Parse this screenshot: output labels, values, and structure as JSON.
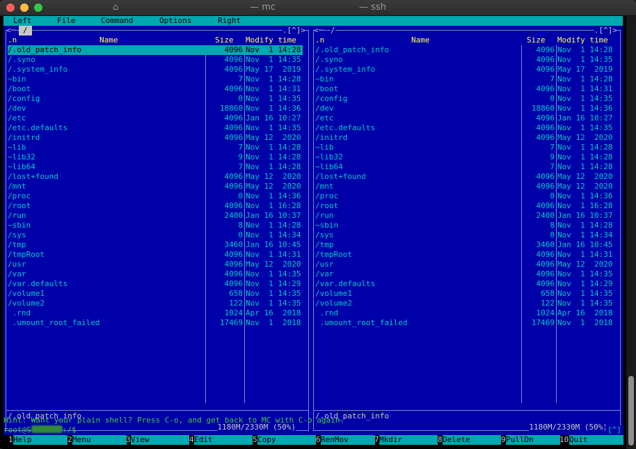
{
  "window": {
    "title_left": "— mc",
    "title_right": "— ssh"
  },
  "menubar": [
    "Left",
    "File",
    "Command",
    "Options",
    "Right"
  ],
  "columns": {
    "name": "Name",
    "size": "Size",
    "mtime": "Modify time",
    "sort": ".n"
  },
  "panels": [
    {
      "path": "/",
      "corner": ".[^]>",
      "nav_left": "<─",
      "selected_index": 0,
      "mini_status": "/.old_patch_info",
      "free_space": "1180M/2330M (50%)"
    },
    {
      "path": "/",
      "corner": ".[^]>",
      "nav_left": "<─",
      "selected_index": -1,
      "mini_status": "/.old_patch_info",
      "free_space": "1180M/2330M (50%)"
    }
  ],
  "files": [
    {
      "name": "/.old_patch_info",
      "size": "4096",
      "mtime": "Nov  1 14:28"
    },
    {
      "name": "/.syno",
      "size": "4096",
      "mtime": "Nov  1 14:35"
    },
    {
      "name": "/.system_info",
      "size": "4096",
      "mtime": "May 17  2019"
    },
    {
      "name": "~bin",
      "size": "7",
      "mtime": "Nov  1 14:28"
    },
    {
      "name": "/boot",
      "size": "4096",
      "mtime": "Nov  1 14:31"
    },
    {
      "name": "/config",
      "size": "0",
      "mtime": "Nov  1 14:35"
    },
    {
      "name": "/dev",
      "size": "18860",
      "mtime": "Nov  1 14:36"
    },
    {
      "name": "/etc",
      "size": "4096",
      "mtime": "Jan 16 10:27"
    },
    {
      "name": "/etc.defaults",
      "size": "4096",
      "mtime": "Nov  1 14:35"
    },
    {
      "name": "/initrd",
      "size": "4096",
      "mtime": "May 12  2020"
    },
    {
      "name": "~lib",
      "size": "7",
      "mtime": "Nov  1 14:28"
    },
    {
      "name": "~lib32",
      "size": "9",
      "mtime": "Nov  1 14:28"
    },
    {
      "name": "~lib64",
      "size": "7",
      "mtime": "Nov  1 14:28"
    },
    {
      "name": "/lost+found",
      "size": "4096",
      "mtime": "May 12  2020"
    },
    {
      "name": "/mnt",
      "size": "4096",
      "mtime": "May 12  2020"
    },
    {
      "name": "/proc",
      "size": "0",
      "mtime": "Nov  1 14:36"
    },
    {
      "name": "/root",
      "size": "4096",
      "mtime": "Nov  1 16:28"
    },
    {
      "name": "/run",
      "size": "2400",
      "mtime": "Jan 16 10:37"
    },
    {
      "name": "~sbin",
      "size": "8",
      "mtime": "Nov  1 14:28"
    },
    {
      "name": "/sys",
      "size": "0",
      "mtime": "Nov  1 14:34"
    },
    {
      "name": "/tmp",
      "size": "3460",
      "mtime": "Jan 16 10:45"
    },
    {
      "name": "/tmpRoot",
      "size": "4096",
      "mtime": "Nov  1 14:31"
    },
    {
      "name": "/usr",
      "size": "4096",
      "mtime": "May 12  2020"
    },
    {
      "name": "/var",
      "size": "4096",
      "mtime": "Nov  1 14:35"
    },
    {
      "name": "/var.defaults",
      "size": "4096",
      "mtime": "Nov  1 14:29"
    },
    {
      "name": "/volume1",
      "size": "658",
      "mtime": "Nov  1 14:35"
    },
    {
      "name": "/volume2",
      "size": "122",
      "mtime": "Nov  1 14:35"
    },
    {
      "name": " .rnd",
      "size": "1024",
      "mtime": "Apr 16  2018"
    },
    {
      "name": " .umount_root_failed",
      "size": "17469",
      "mtime": "Nov  1  2018"
    }
  ],
  "hint": "Hint: Want your plain shell? Press C-o, and get back to MC with C-o again.",
  "prompt": {
    "user": "root@S",
    "suffix": ":/$"
  },
  "history_button": "[^]",
  "fkeys": [
    {
      "num": "1",
      "label": "Help"
    },
    {
      "num": "2",
      "label": "Menu"
    },
    {
      "num": "3",
      "label": "View"
    },
    {
      "num": "4",
      "label": "Edit"
    },
    {
      "num": "5",
      "label": "Copy"
    },
    {
      "num": "6",
      "label": "RenMov"
    },
    {
      "num": "7",
      "label": "Mkdir"
    },
    {
      "num": "8",
      "label": "Delete"
    },
    {
      "num": "9",
      "label": "PullDn"
    },
    {
      "num": "10",
      "label": "Quit"
    }
  ]
}
